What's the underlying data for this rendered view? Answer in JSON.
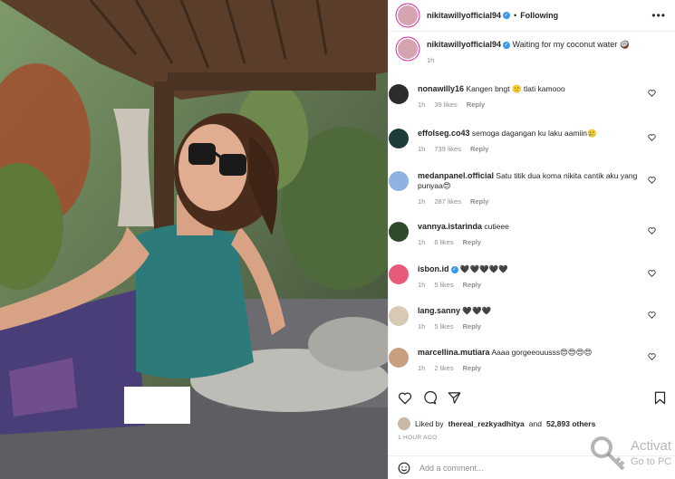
{
  "header": {
    "username": "nikitawillyofficial94",
    "separator": "•",
    "follow_label": "Following",
    "more": "•••"
  },
  "caption": {
    "username": "nikitawillyofficial94",
    "text": "Waiting for my coconut water 🥥",
    "time": "1h"
  },
  "comments": [
    {
      "username": "nonawilly16",
      "verified": false,
      "text": "Kangen bngt 🙂 tlati kamooo",
      "time": "1h",
      "likes": "39 likes",
      "reply": "Reply",
      "avatar_color": "#2b2b2b"
    },
    {
      "username": "effolseg.co43",
      "verified": false,
      "text": "semoga dagangan ku laku aamiin🥲",
      "time": "1h",
      "likes": "739 likes",
      "reply": "Reply",
      "avatar_color": "#1f3b3b"
    },
    {
      "username": "medanpanel.official",
      "verified": false,
      "text": "Satu titik dua koma nikita cantik aku yang punyaa😍",
      "time": "1h",
      "likes": "287 likes",
      "reply": "Reply",
      "avatar_color": "#8fb3e0"
    },
    {
      "username": "vannya.istarinda",
      "verified": false,
      "text": "cutieee",
      "time": "1h",
      "likes": "6 likes",
      "reply": "Reply",
      "avatar_color": "#2e4a2a"
    },
    {
      "username": "isbon.id",
      "verified": true,
      "text": "🖤🖤🖤🖤🖤",
      "time": "1h",
      "likes": "5 likes",
      "reply": "Reply",
      "avatar_color": "#e85a7a"
    },
    {
      "username": "lang.sanny",
      "verified": false,
      "text": "🖤🖤🖤",
      "time": "1h",
      "likes": "5 likes",
      "reply": "Reply",
      "avatar_color": "#d8c9b5"
    },
    {
      "username": "marcellina.mutiara",
      "verified": false,
      "text": "Aaaa gorgeeouusss😍😍😍😍",
      "time": "1h",
      "likes": "2 likes",
      "reply": "Reply",
      "avatar_color": "#c8a080"
    }
  ],
  "likes": {
    "text_prefix": "Liked by",
    "user": "thereal_rezkyadhitya",
    "text_mid": "and",
    "count": "52,893 others"
  },
  "time_ago": "1 HOUR AGO",
  "add_comment": {
    "placeholder": "Add a comment..."
  },
  "watermark": {
    "line1": "Activat",
    "line2": "Go to PC"
  },
  "colors": {
    "verified": "#3897f0",
    "story_ring": "#d6249f"
  }
}
